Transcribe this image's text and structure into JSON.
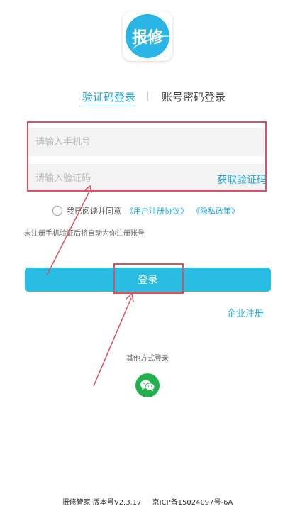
{
  "logo": {
    "text": "报修"
  },
  "tabs": [
    {
      "label": "验证码登录",
      "active": true
    },
    {
      "label": "账号密码登录",
      "active": false
    }
  ],
  "tab_separator": "|",
  "form": {
    "phone_placeholder": "请输入手机号",
    "phone_value": "",
    "code_placeholder": "请输入验证码",
    "code_value": "",
    "get_code_label": "获取验证码"
  },
  "agreement": {
    "prefix": "我已阅读并同意",
    "user_agreement": "《用户注册协议》",
    "privacy_policy": "《隐私政策》",
    "checked": false
  },
  "hint": "未注册手机验证后将自动为你注册账号",
  "login_label": "登录",
  "enterprise_register": "企业注册",
  "other_login_label": "其他方式登录",
  "footer": {
    "version": "报修管家 版本号V2.3.17",
    "icp": "京ICP备15024097号-6A"
  },
  "colors": {
    "accent": "#29bde3",
    "link": "#23a8d8",
    "highlight": "#e15060",
    "wechat": "#22b14c"
  },
  "icons": {
    "wechat": "wechat-icon"
  }
}
